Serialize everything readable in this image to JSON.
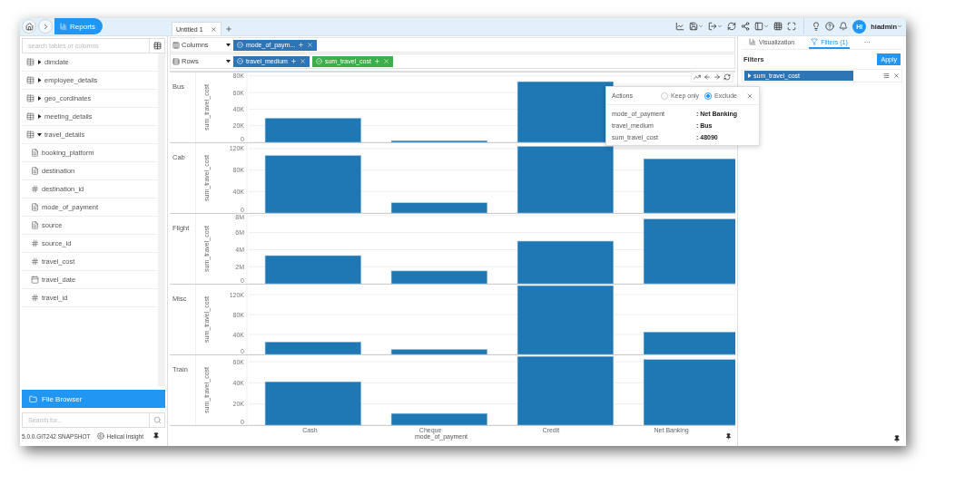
{
  "breadcrumb": {
    "label": "Reports"
  },
  "tabs": [
    {
      "label": "Untitled 1",
      "selected": true
    }
  ],
  "user": {
    "initials": "HI",
    "name": "hiadmin"
  },
  "sidebar": {
    "search": {
      "placeholder": "search tables or columns"
    },
    "tree": [
      {
        "label": "dimdate",
        "expanded": false
      },
      {
        "label": "employee_details",
        "expanded": false
      },
      {
        "label": "geo_cordinates",
        "expanded": false
      },
      {
        "label": "meeting_details",
        "expanded": false
      },
      {
        "label": "travel_details",
        "expanded": true,
        "children": [
          {
            "label": "booking_platform",
            "kind": "text"
          },
          {
            "label": "destination",
            "kind": "text"
          },
          {
            "label": "destination_id",
            "kind": "number"
          },
          {
            "label": "mode_of_payment",
            "kind": "text"
          },
          {
            "label": "source",
            "kind": "text"
          },
          {
            "label": "source_id",
            "kind": "number"
          },
          {
            "label": "travel_cost",
            "kind": "number"
          },
          {
            "label": "travel_date",
            "kind": "date"
          },
          {
            "label": "travel_id",
            "kind": "number"
          }
        ]
      }
    ],
    "file_browser": "File Browser",
    "file_search": {
      "placeholder": "Search for..."
    },
    "version": "5.0.0.GIT242 SNAPSHOT",
    "brand": "Helical Insight"
  },
  "shelves": [
    {
      "label": "Columns",
      "kind": "columns",
      "pills": [
        {
          "label": "mode_of_paym...",
          "color": "#2e75b6"
        }
      ]
    },
    {
      "label": "Rows",
      "kind": "rows",
      "pills": [
        {
          "label": "travel_medium",
          "color": "#2e75b6"
        },
        {
          "label": "sum_travel_cost",
          "color": "#3cae4a"
        }
      ]
    }
  ],
  "charts": [
    {
      "row_label": "Bus",
      "chart_data": {
        "type": "bar",
        "ylabel": "sum_travel_cost",
        "grid": true,
        "ylim": [
          0,
          84000
        ],
        "yticks": [
          {
            "value": 0,
            "label": "0"
          },
          {
            "value": 20000,
            "label": "20K"
          },
          {
            "value": 40000,
            "label": "40K"
          },
          {
            "value": 60000,
            "label": "60K"
          },
          {
            "value": 80000,
            "label": "80K"
          }
        ],
        "values": [
          29000,
          2000,
          73000,
          null
        ]
      }
    },
    {
      "row_label": "Cab",
      "chart_data": {
        "type": "bar",
        "ylabel": "sum_travel_cost",
        "grid": true,
        "ylim": [
          0,
          130000
        ],
        "yticks": [
          {
            "value": 0,
            "label": "0"
          },
          {
            "value": 40000,
            "label": "40K"
          },
          {
            "value": 80000,
            "label": "80K"
          },
          {
            "value": 120000,
            "label": "120K"
          }
        ],
        "values": [
          107000,
          19000,
          124000,
          101000
        ]
      }
    },
    {
      "row_label": "Flight",
      "chart_data": {
        "type": "bar",
        "ylabel": "sum_travel_cost",
        "grid": true,
        "ylim": [
          0,
          8200000
        ],
        "yticks": [
          {
            "value": 0,
            "label": "0"
          },
          {
            "value": 2000000,
            "label": "2M"
          },
          {
            "value": 4000000,
            "label": "4M"
          },
          {
            "value": 6000000,
            "label": "6M"
          },
          {
            "value": 8000000,
            "label": "8M"
          }
        ],
        "values": [
          3300000,
          1500000,
          5000000,
          7600000
        ]
      }
    },
    {
      "row_label": "Misc",
      "chart_data": {
        "type": "bar",
        "ylabel": "sum_travel_cost",
        "grid": true,
        "ylim": [
          0,
          140000
        ],
        "yticks": [
          {
            "value": 0,
            "label": "0"
          },
          {
            "value": 40000,
            "label": "40K"
          },
          {
            "value": 80000,
            "label": "80K"
          },
          {
            "value": 120000,
            "label": "120K"
          }
        ],
        "values": [
          25000,
          10000,
          138000,
          45000
        ]
      }
    },
    {
      "row_label": "Train",
      "chart_data": {
        "type": "bar",
        "ylabel": "sum_travel_cost",
        "grid": true,
        "ylim": [
          0,
          66000
        ],
        "yticks": [
          {
            "value": 0,
            "label": "0"
          },
          {
            "value": 20000,
            "label": "20K"
          },
          {
            "value": 40000,
            "label": "40K"
          },
          {
            "value": 60000,
            "label": "60K"
          }
        ],
        "values": [
          41000,
          11000,
          65000,
          62000
        ]
      }
    }
  ],
  "x_axis": {
    "categories": [
      "Cash",
      "Cheque",
      "Credit",
      "Net Banking"
    ],
    "label": "mode_of_payment"
  },
  "popup": {
    "title": "Actions",
    "options": [
      {
        "label": "Keep only",
        "selected": false
      },
      {
        "label": "Exclude",
        "selected": true
      }
    ],
    "details": [
      {
        "key": "mode_of_payment",
        "value": ": Net Banking"
      },
      {
        "key": "travel_medium",
        "value": ": Bus"
      },
      {
        "key": "sum_travel_cost",
        "value": ": 48090"
      }
    ]
  },
  "right_panel": {
    "tabs": [
      {
        "label": "Visualization",
        "kind": "viz",
        "selected": false
      },
      {
        "label": "Filters (1)",
        "kind": "filter",
        "selected": true
      },
      {
        "label": "···",
        "kind": "more",
        "selected": false
      }
    ],
    "heading": "Filters",
    "apply": "Apply",
    "filters": [
      {
        "label": "sum_travel_cost",
        "expanded": false
      }
    ]
  }
}
